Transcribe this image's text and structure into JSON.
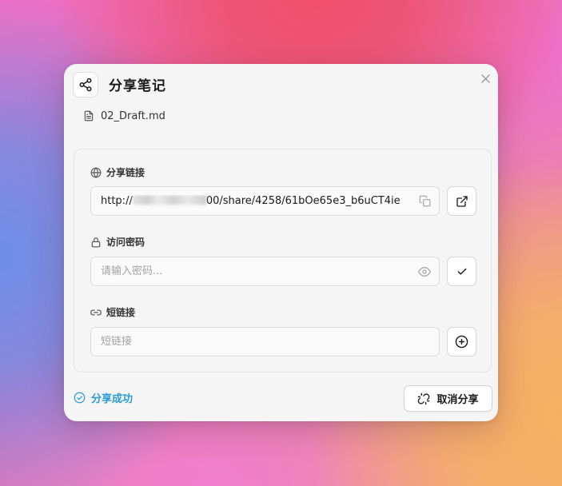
{
  "dialog": {
    "title": "分享笔记",
    "file_name": "02_Draft.md"
  },
  "share_link": {
    "label": "分享链接",
    "url_prefix": "http://",
    "url_suffix": "00/share/4258/61bOe65e3_b6uCT4ie"
  },
  "password": {
    "label": "访问密码",
    "placeholder": "请输入密码..."
  },
  "short_link": {
    "label": "短链接",
    "placeholder": "短链接"
  },
  "footer": {
    "status": "分享成功",
    "cancel_label": "取消分享"
  },
  "colors": {
    "status": "#2b9bd6"
  }
}
